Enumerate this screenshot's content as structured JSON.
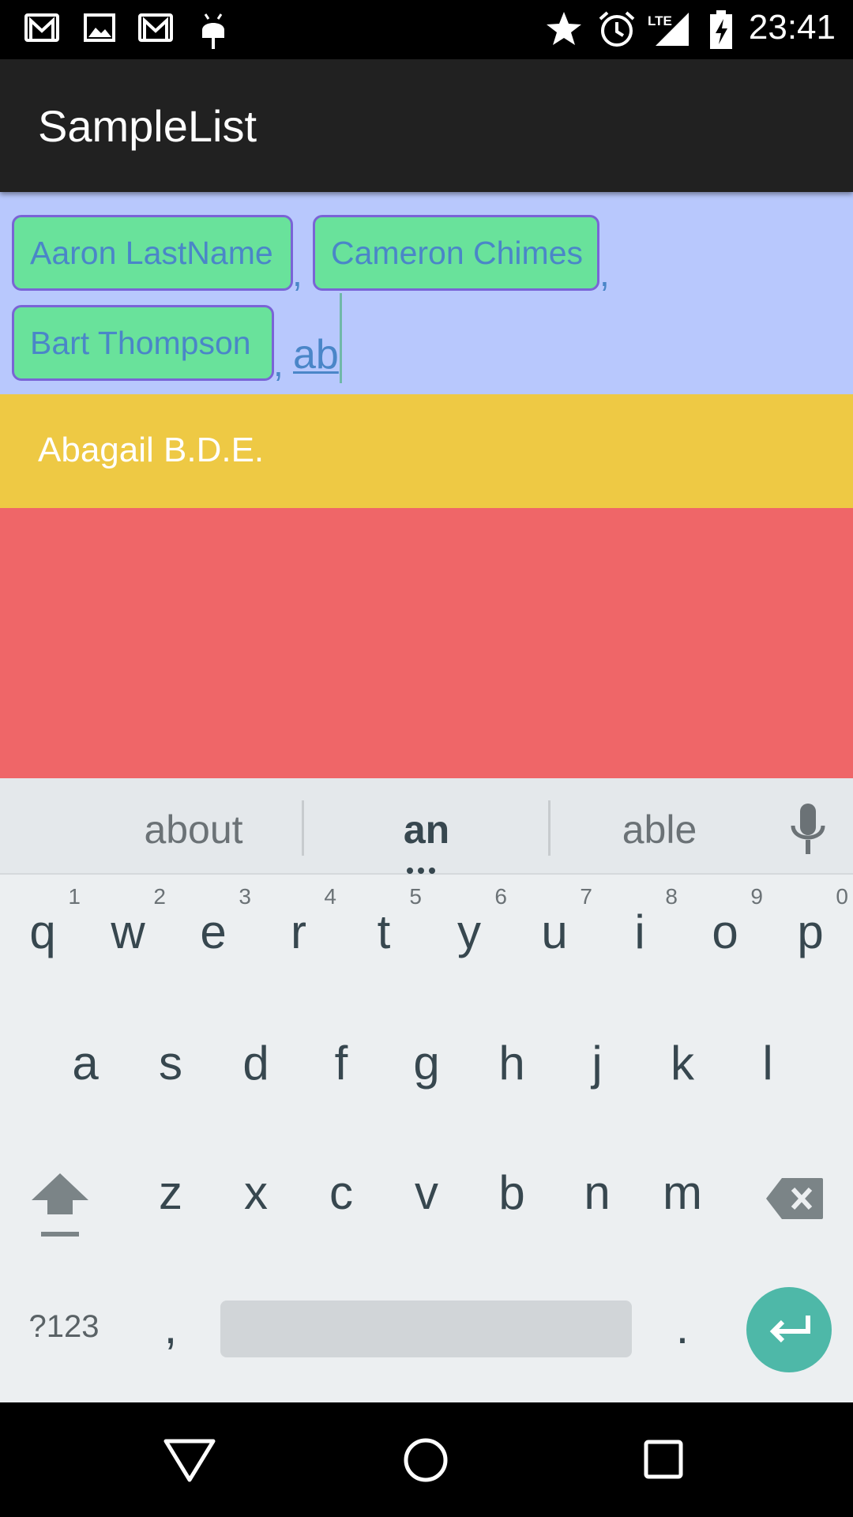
{
  "status_bar": {
    "time": "23:41",
    "left_icons": [
      "gmail-icon",
      "image-icon",
      "gmail-icon",
      "android-debug-icon"
    ],
    "right_icons": [
      "star-icon",
      "alarm-icon",
      "lte-signal-icon",
      "battery-charging-icon"
    ],
    "lte_label": "LTE"
  },
  "app_bar": {
    "title": "SampleList"
  },
  "chips": [
    {
      "label": "Aaron LastName"
    },
    {
      "label": "Cameron Chimes"
    },
    {
      "label": "Bart Thompson"
    }
  ],
  "separator": ",",
  "input": {
    "typed_text": "ab"
  },
  "suggestion_row": {
    "label": "Abagail B.D.E."
  },
  "keyboard": {
    "suggestions": [
      "about",
      "an",
      "able"
    ],
    "row1": [
      {
        "ch": "q",
        "hint": "1"
      },
      {
        "ch": "w",
        "hint": "2"
      },
      {
        "ch": "e",
        "hint": "3"
      },
      {
        "ch": "r",
        "hint": "4"
      },
      {
        "ch": "t",
        "hint": "5"
      },
      {
        "ch": "y",
        "hint": "6"
      },
      {
        "ch": "u",
        "hint": "7"
      },
      {
        "ch": "i",
        "hint": "8"
      },
      {
        "ch": "o",
        "hint": "9"
      },
      {
        "ch": "p",
        "hint": "0"
      }
    ],
    "row2": [
      "a",
      "s",
      "d",
      "f",
      "g",
      "h",
      "j",
      "k",
      "l"
    ],
    "row3": [
      "z",
      "x",
      "c",
      "v",
      "b",
      "n",
      "m"
    ],
    "symbols_label": "?123",
    "comma_label": ",",
    "period_label": "."
  },
  "colors": {
    "chips_bg": "#b8c8fd",
    "chip_bg": "#69e29b",
    "suggestion_bg": "#eec944",
    "empty_bg": "#ef6668",
    "enter_key": "#4eb8a8"
  }
}
